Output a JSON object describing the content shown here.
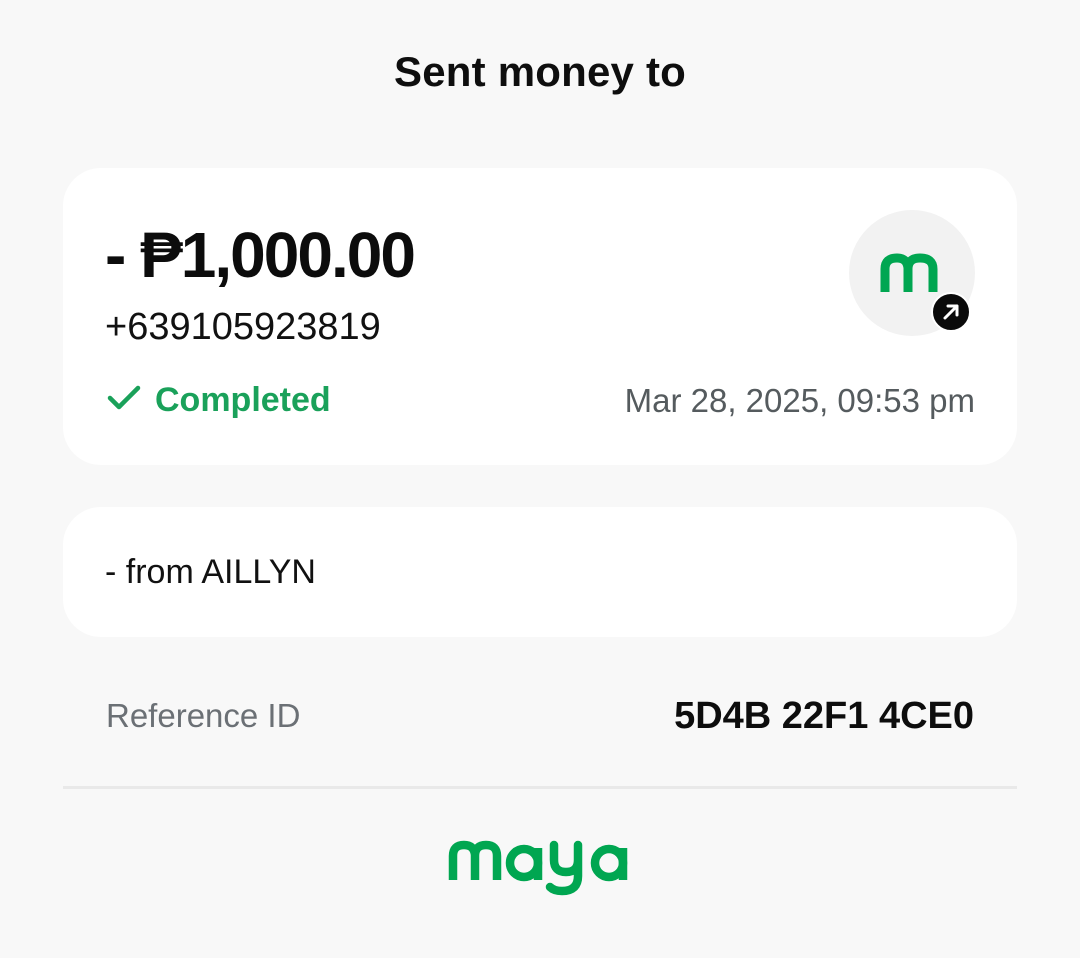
{
  "header": {
    "title": "Sent money to"
  },
  "transaction": {
    "amount": "- ₱1,000.00",
    "recipient": "+639105923819",
    "status": "Completed",
    "timestamp": "Mar 28, 2025, 09:53 pm",
    "avatar_icon": "maya-m-logo-icon",
    "avatar_badge_icon": "arrow-up-right-icon"
  },
  "note": {
    "text": "- from AILLYN"
  },
  "reference": {
    "label": "Reference ID",
    "value": "5D4B 22F1 4CE0"
  },
  "footer": {
    "brand": "maya",
    "brand_icon": "maya-logo"
  },
  "colors": {
    "brand_green": "#00a651",
    "status_green": "#1aa15a",
    "background": "#f8f8f8",
    "card": "#ffffff"
  }
}
